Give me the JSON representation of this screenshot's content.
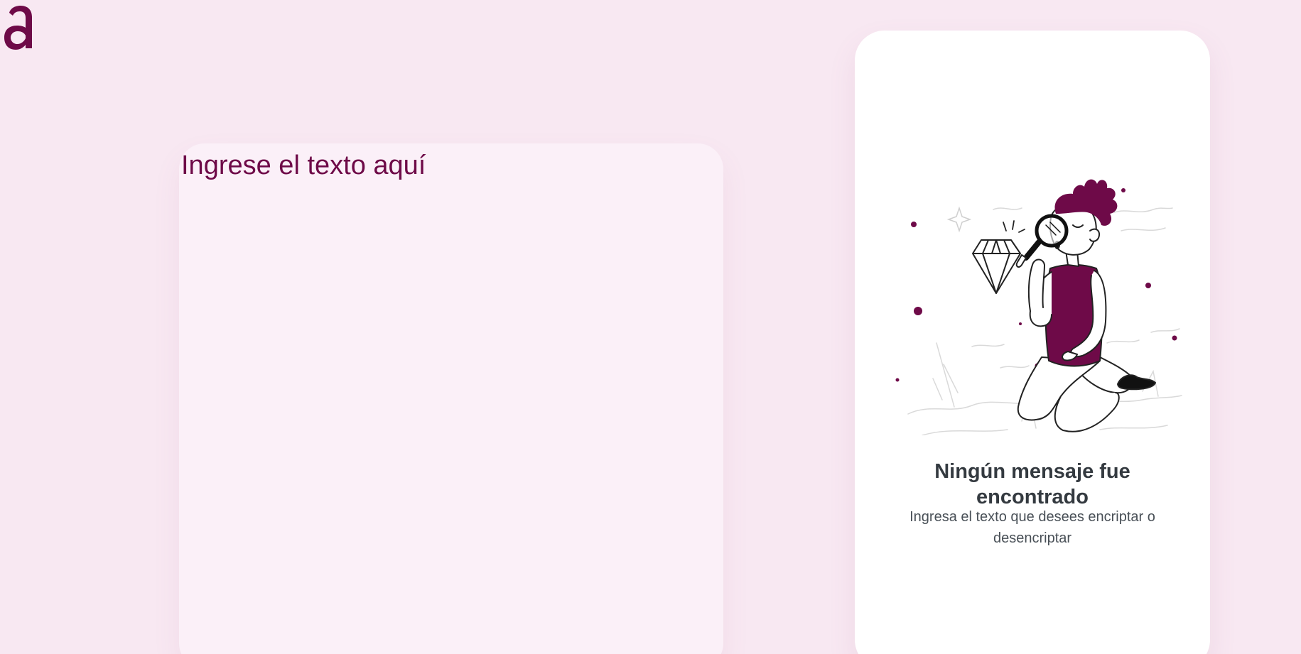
{
  "brand": {
    "logo_letter": "a",
    "color": "#6e0a48"
  },
  "input": {
    "placeholder": "Ingrese el texto aquí",
    "value": ""
  },
  "result": {
    "empty_title": "Ningún mensaje fue encontrado",
    "empty_subtitle": "Ingresa el texto que desees encriptar o desencriptar",
    "illustration_icon": "person-magnifying-glass-diamond-illustration"
  },
  "colors": {
    "background": "#f8e8f2",
    "accent": "#6e0a48",
    "input_card": "#fbf0f8",
    "result_card": "#ffffff",
    "title_text": "#343a40",
    "body_text": "#495057"
  }
}
